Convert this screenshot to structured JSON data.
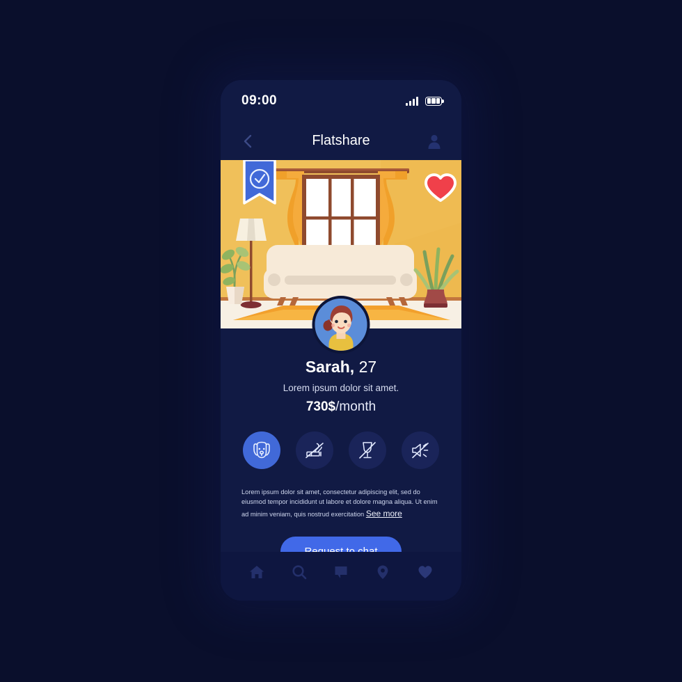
{
  "status_bar": {
    "time": "09:00",
    "signal_icon": "signal-bars-icon",
    "battery_icon": "battery-icon"
  },
  "header": {
    "title": "Flatshare",
    "back_icon": "chevron-left-icon",
    "profile_icon": "person-icon"
  },
  "hero": {
    "badge_icon": "verified-check-ribbon-icon",
    "favorite_icon": "heart-icon",
    "illustration": "living-room-illustration",
    "colors": {
      "wall": "#f0c05a",
      "curtain": "#f0a02a",
      "frame": "#8f4a2e",
      "sofa": "#f7ead8",
      "rug": "#f2a02c",
      "heart": "#f0404a",
      "badge": "#4169d8"
    }
  },
  "profile": {
    "avatar_icon": "user-avatar",
    "name": "Sarah,",
    "age": "27",
    "tagline": "Lorem ipsum dolor sit amet.",
    "price_amount": "730$",
    "price_period": "/month"
  },
  "amenities": [
    {
      "id": "pet-friendly",
      "icon": "dog-face-icon",
      "active": true
    },
    {
      "id": "no-smoking",
      "icon": "no-smoking-icon",
      "active": false
    },
    {
      "id": "no-alcohol",
      "icon": "no-alcohol-icon",
      "active": false
    },
    {
      "id": "no-noise",
      "icon": "no-noise-icon",
      "active": false
    }
  ],
  "description": {
    "body": "Lorem ipsum dolor sit amet, consectetur adipiscing elit, sed do eiusmod tempor incididunt ut labore et dolore magna aliqua. Ut enim ad minim veniam, quis nostrud exercitation",
    "see_more": "See more"
  },
  "cta": {
    "label": "Request to chat"
  },
  "bottom_nav": [
    {
      "id": "home",
      "icon": "home-icon"
    },
    {
      "id": "search",
      "icon": "search-icon"
    },
    {
      "id": "messages",
      "icon": "chat-bubble-icon"
    },
    {
      "id": "map",
      "icon": "location-pin-icon"
    },
    {
      "id": "favorites",
      "icon": "heart-icon"
    }
  ],
  "theme": {
    "background": "#0a0f2c",
    "phone_bg": "#111a44",
    "accent": "#4169e8",
    "nav_inactive": "#24306b"
  }
}
